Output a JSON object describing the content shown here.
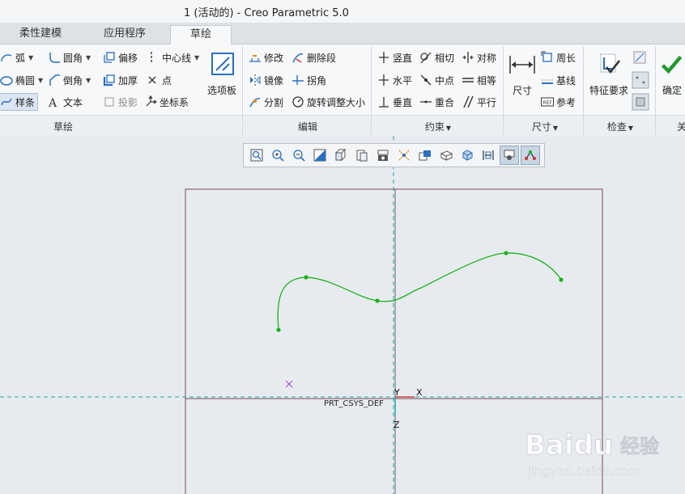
{
  "window": {
    "title": "1 (活动的) - Creo Parametric 5.0"
  },
  "tabs": [
    {
      "label": "柔性建模"
    },
    {
      "label": "应用程序"
    },
    {
      "label": "草绘",
      "active": true
    }
  ],
  "ribbon": {
    "sketch": {
      "label": "草绘",
      "arc": "弧",
      "ellipse": "椭圆",
      "spline": "样条",
      "fillet": "圆角",
      "chamfer": "倒角",
      "text": "文本",
      "offset": "偏移",
      "thicken": "加厚",
      "project": "投影",
      "centerline": "中心线",
      "point": "点",
      "csys": "坐标系",
      "palette": "选项板"
    },
    "edit": {
      "label": "编辑",
      "modify": "修改",
      "mirror": "镜像",
      "divide": "分割",
      "delete_segment": "删除段",
      "corner": "拐角",
      "rotate_resize": "旋转调整大小"
    },
    "constrain": {
      "label": "约束",
      "vertical": "竖直",
      "horizontal": "水平",
      "perpendicular": "垂直",
      "tangent": "相切",
      "midpoint": "中点",
      "coincident": "重合",
      "symmetric": "对称",
      "equal": "相等",
      "parallel": "平行"
    },
    "dimension": {
      "label": "尺寸",
      "dimension": "尺寸",
      "perimeter": "周长",
      "baseline": "基线",
      "reference": "参考",
      "ref_badge": "REF"
    },
    "inspect": {
      "label": "检查",
      "feature_requirements": "特征要求"
    },
    "close": {
      "label": "关",
      "ok": "确定"
    }
  },
  "canvas": {
    "csys_label": "PRT_CSYS_DEF",
    "axis_y": "Y",
    "axis_x": "X",
    "axis_z": "Z"
  },
  "colors": {
    "spline": "#19b219",
    "datum": "#1fa7a7",
    "frame": "#7a4a55",
    "accent_check": "#1e9a2e"
  },
  "watermark": {
    "brand": "Baidu",
    "word": "经验",
    "url": "jingyan.baidu.com"
  }
}
